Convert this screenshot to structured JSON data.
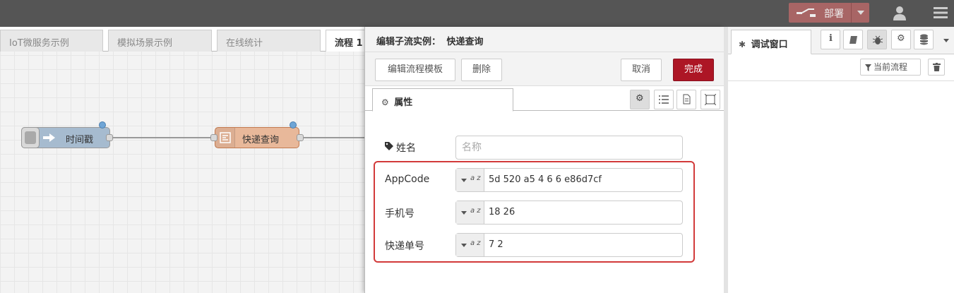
{
  "header": {
    "deploy_label": "部署"
  },
  "workspace": {
    "tabs": [
      {
        "label": "IoT微服务示例"
      },
      {
        "label": "模拟场景示例"
      },
      {
        "label": "在线统计"
      },
      {
        "label": "流程 1"
      }
    ],
    "nodes": [
      {
        "label": "时间戳"
      },
      {
        "label": "快递查询"
      }
    ]
  },
  "editor": {
    "title_prefix": "编辑子流实例：",
    "title_name": "快递查询",
    "edit_template_label": "编辑流程模板",
    "delete_label": "删除",
    "cancel_label": "取消",
    "done_label": "完成",
    "properties_tab": "属性",
    "fields": {
      "name_label": "姓名",
      "name_placeholder": "名称",
      "appcode_label": "AppCode",
      "appcode_value": "5d  520 a5   4    6   6 e86d7cf",
      "phone_label": "手机号",
      "phone_value": "18         26",
      "tracking_label": "快递单号",
      "tracking_value": "7            2",
      "type_marker": "a z"
    }
  },
  "sidebar": {
    "debug_tab": "调试窗口",
    "filter_label": "当前流程"
  }
}
